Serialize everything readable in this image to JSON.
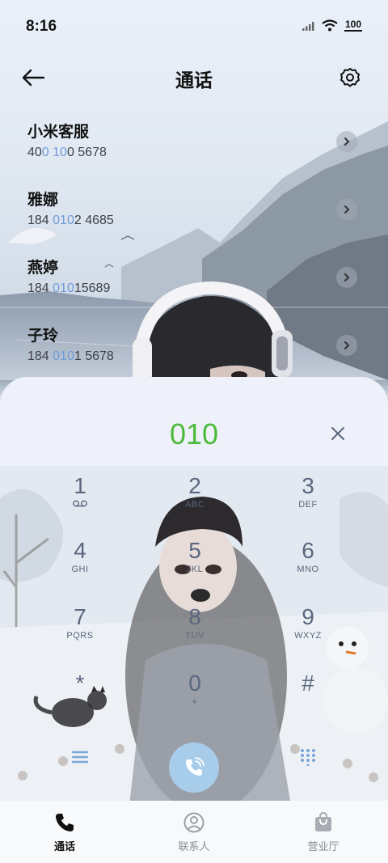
{
  "status_bar": {
    "time": "8:16",
    "battery": "100",
    "icons": [
      "signal-icon",
      "wifi-icon",
      "battery-icon"
    ]
  },
  "header": {
    "title": "通话",
    "back_icon": "back-arrow-icon",
    "settings_icon": "gear-icon"
  },
  "call_log": [
    {
      "name": "小米客服",
      "number_prefix": "40",
      "number_match": "0 10",
      "number_suffix": "0 5678"
    },
    {
      "name": "雅娜",
      "number_prefix": "184 ",
      "number_match": "010",
      "number_suffix": "2 4685"
    },
    {
      "name": "燕婷",
      "number_prefix": "184 ",
      "number_match": "010",
      "number_suffix": "15689"
    },
    {
      "name": "子玲",
      "number_prefix": "184 ",
      "number_match": "010",
      "number_suffix": "1 5678"
    }
  ],
  "dialer": {
    "input_value": "010",
    "input_color": "#4cbb3c",
    "highlight_color": "#6f9ad8",
    "keys": [
      {
        "digit": "1",
        "letters": "voicemail-icon"
      },
      {
        "digit": "2",
        "letters": "ABC"
      },
      {
        "digit": "3",
        "letters": "DEF"
      },
      {
        "digit": "4",
        "letters": "GHI"
      },
      {
        "digit": "5",
        "letters": "JKL"
      },
      {
        "digit": "6",
        "letters": "MNO"
      },
      {
        "digit": "7",
        "letters": "PQRS"
      },
      {
        "digit": "8",
        "letters": "TUV"
      },
      {
        "digit": "9",
        "letters": "WXYZ"
      },
      {
        "digit": "*",
        "letters": ","
      },
      {
        "digit": "0",
        "letters": "+"
      },
      {
        "digit": "#",
        "letters": ""
      }
    ],
    "call_button_color": "#a8cdea"
  },
  "bottom_nav": {
    "items": [
      {
        "label": "通话",
        "icon": "phone-icon",
        "active": true
      },
      {
        "label": "联系人",
        "icon": "person-icon",
        "active": false
      },
      {
        "label": "营业厅",
        "icon": "bag-icon",
        "active": false
      }
    ]
  }
}
